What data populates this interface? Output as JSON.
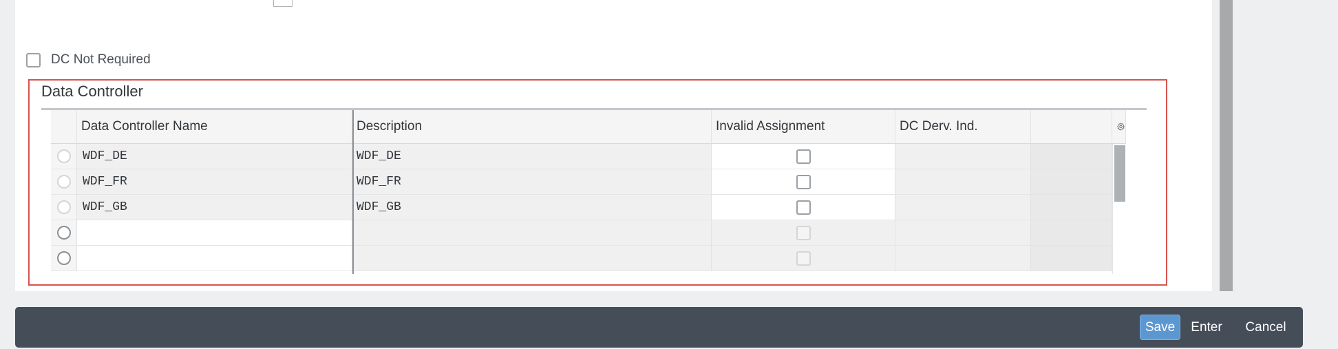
{
  "dc_not_required": {
    "label": "DC Not Required",
    "checked": false
  },
  "section": {
    "title": "Data Controller"
  },
  "table": {
    "columns": [
      "Data Controller Name",
      "Description",
      "Invalid Assignment",
      "DC Derv. Ind."
    ],
    "rows": [
      {
        "name": "WDF_DE",
        "description": "WDF_DE",
        "invalid": false,
        "dc_derv": ""
      },
      {
        "name": "WDF_FR",
        "description": "WDF_FR",
        "invalid": false,
        "dc_derv": ""
      },
      {
        "name": "WDF_GB",
        "description": "WDF_GB",
        "invalid": false,
        "dc_derv": ""
      },
      {
        "name": "",
        "description": "",
        "invalid": false,
        "dc_derv": ""
      },
      {
        "name": "",
        "description": "",
        "invalid": false,
        "dc_derv": ""
      }
    ],
    "settings_icon": "gear-icon"
  },
  "footer": {
    "save": "Save",
    "enter": "Enter",
    "cancel": "Cancel"
  },
  "colors": {
    "footer_bg": "#454d59",
    "save_bg": "#5b97d0",
    "highlight": "#d9534f"
  }
}
